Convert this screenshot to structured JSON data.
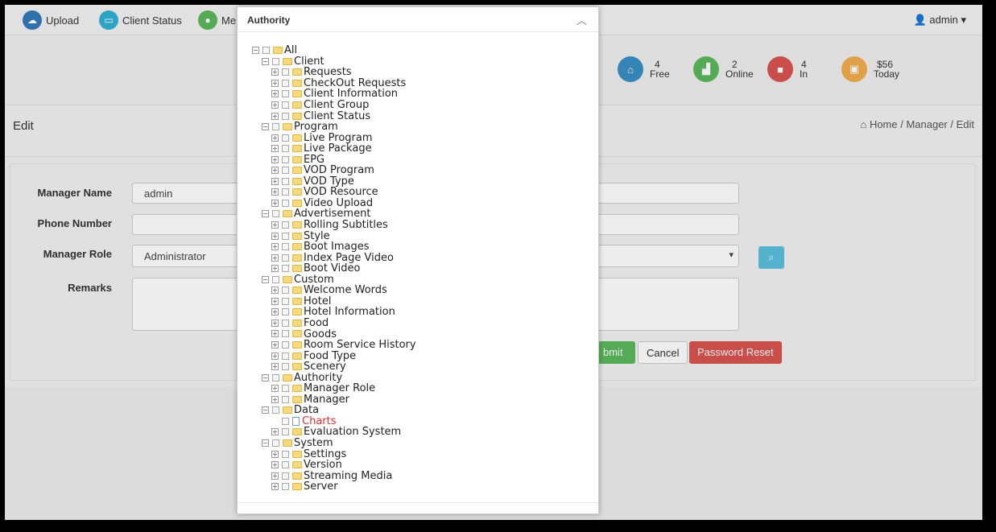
{
  "nav": {
    "items": [
      {
        "label": "Upload",
        "color": "#337ab7"
      },
      {
        "label": "Client Status",
        "color": "#31b0d5"
      },
      {
        "label": "Me",
        "color": "#5cb85c"
      }
    ],
    "user": "admin"
  },
  "stats": [
    {
      "value": "4",
      "label": "Free",
      "color": "#3a8fc4"
    },
    {
      "value": "2",
      "label": "Online",
      "color": "#5cb85c"
    },
    {
      "value": "4",
      "label": "In",
      "color": "#d9534f"
    },
    {
      "value": "$56",
      "label": "Today",
      "color": "#f0ad4e"
    }
  ],
  "page": {
    "title": "Edit",
    "breadcrumb": "Home / Manager / Edit"
  },
  "form": {
    "manager_name_label": "Manager Name",
    "manager_name_value": "admin",
    "phone_label": "Phone Number",
    "phone_value": "",
    "role_label": "Manager Role",
    "role_value": "Administrator",
    "remarks_label": "Remarks",
    "remarks_value": "",
    "submit_label": "bmit",
    "cancel_label": "Cancel",
    "reset_label": "Password Reset"
  },
  "modal": {
    "title": "Authority",
    "tree": [
      {
        "label": "All",
        "depth": 0
      },
      {
        "label": "Client",
        "depth": 1
      },
      {
        "label": "Requests",
        "depth": 2
      },
      {
        "label": "CheckOut Requests",
        "depth": 2
      },
      {
        "label": "Client Information",
        "depth": 2
      },
      {
        "label": "Client Group",
        "depth": 2
      },
      {
        "label": "Client Status",
        "depth": 2
      },
      {
        "label": "Program",
        "depth": 1
      },
      {
        "label": "Live Program",
        "depth": 2
      },
      {
        "label": "Live Package",
        "depth": 2
      },
      {
        "label": "EPG",
        "depth": 2
      },
      {
        "label": "VOD Program",
        "depth": 2
      },
      {
        "label": "VOD Type",
        "depth": 2
      },
      {
        "label": "VOD Resource",
        "depth": 2
      },
      {
        "label": "Video Upload",
        "depth": 2
      },
      {
        "label": "Advertisement",
        "depth": 1
      },
      {
        "label": "Rolling Subtitles",
        "depth": 2
      },
      {
        "label": "Style",
        "depth": 2
      },
      {
        "label": "Boot Images",
        "depth": 2
      },
      {
        "label": "Index Page Video",
        "depth": 2
      },
      {
        "label": "Boot Video",
        "depth": 2
      },
      {
        "label": "Custom",
        "depth": 1
      },
      {
        "label": "Welcome Words",
        "depth": 2
      },
      {
        "label": "Hotel",
        "depth": 2
      },
      {
        "label": "Hotel Information",
        "depth": 2
      },
      {
        "label": "Food",
        "depth": 2
      },
      {
        "label": "Goods",
        "depth": 2
      },
      {
        "label": "Room Service History",
        "depth": 2
      },
      {
        "label": "Food Type",
        "depth": 2
      },
      {
        "label": "Scenery",
        "depth": 2
      },
      {
        "label": "Authority",
        "depth": 1
      },
      {
        "label": "Manager Role",
        "depth": 2
      },
      {
        "label": "Manager",
        "depth": 2
      },
      {
        "label": "Data",
        "depth": 1
      },
      {
        "label": "Charts",
        "depth": 2,
        "leaf": true,
        "active": true
      },
      {
        "label": "Evaluation System",
        "depth": 2
      },
      {
        "label": "System",
        "depth": 1
      },
      {
        "label": "Settings",
        "depth": 2
      },
      {
        "label": "Version",
        "depth": 2
      },
      {
        "label": "Streaming Media",
        "depth": 2
      },
      {
        "label": "Server",
        "depth": 2
      }
    ]
  }
}
